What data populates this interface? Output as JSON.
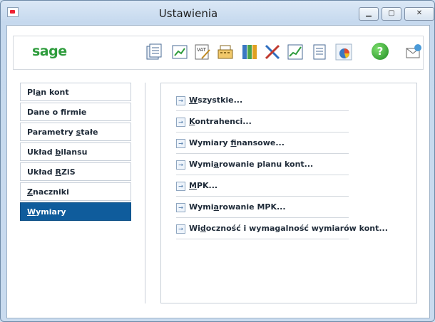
{
  "window": {
    "title": "Ustawienia"
  },
  "toolbar": {
    "brand": "sage",
    "help": "?"
  },
  "nav": [
    {
      "pre": "Pl",
      "acc": "a",
      "post": "n kont"
    },
    {
      "pre": "Dane o f",
      "acc": "i",
      "post": "rmie"
    },
    {
      "pre": "Parametry ",
      "acc": "s",
      "post": "tałe"
    },
    {
      "pre": "Układ ",
      "acc": "b",
      "post": "ilansu"
    },
    {
      "pre": "Układ ",
      "acc": "R",
      "post": "ZiS"
    },
    {
      "pre": "",
      "acc": "Z",
      "post": "naczniki"
    },
    {
      "pre": "",
      "acc": "W",
      "post": "ymiary"
    }
  ],
  "links": [
    {
      "pre": "",
      "acc": "W",
      "post": "szystkie..."
    },
    {
      "pre": "",
      "acc": "K",
      "post": "ontrahenci..."
    },
    {
      "pre": "Wymiary ",
      "acc": "f",
      "post": "inansowe..."
    },
    {
      "pre": "Wymi",
      "acc": "a",
      "post": "rowanie planu kont..."
    },
    {
      "pre": "",
      "acc": "M",
      "post": "PK..."
    },
    {
      "pre": "Wymi",
      "acc": "a",
      "post": "rowanie MPK..."
    },
    {
      "pre": "Wi",
      "acc": "d",
      "post": "oczność i wymagalność wymiarów kont..."
    }
  ],
  "colors": {
    "selected": "#0f5c9c",
    "brand": "#2e9c3c"
  }
}
